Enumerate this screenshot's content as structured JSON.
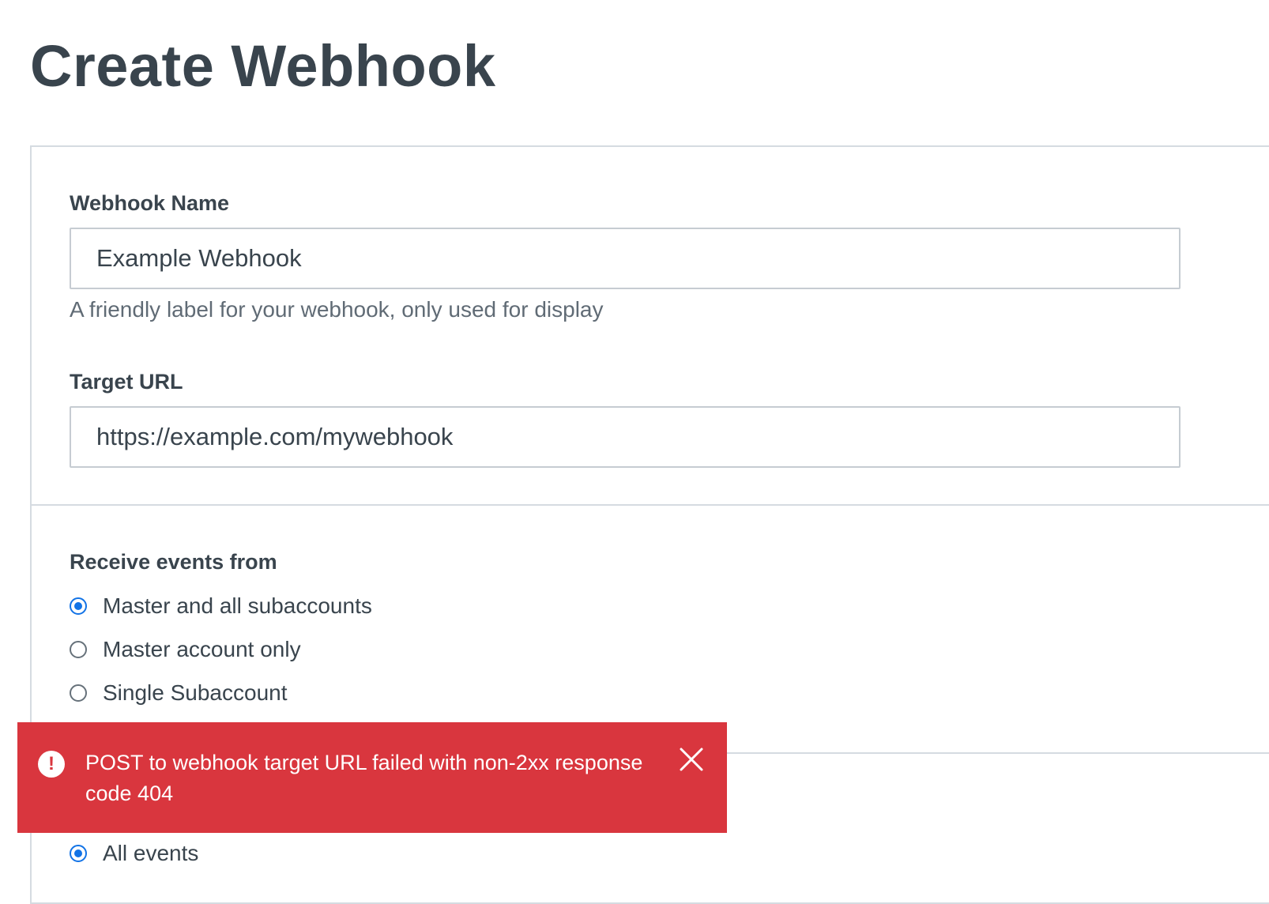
{
  "page": {
    "title": "Create Webhook"
  },
  "form": {
    "name_field": {
      "label": "Webhook Name",
      "value": "Example Webhook",
      "help": "A friendly label for your webhook, only used for display"
    },
    "url_field": {
      "label": "Target URL",
      "value": "https://example.com/mywebhook"
    },
    "receive_events": {
      "label": "Receive events from",
      "options": [
        {
          "label": "Master and all subaccounts",
          "checked": true
        },
        {
          "label": "Master account only",
          "checked": false
        },
        {
          "label": "Single Subaccount",
          "checked": false
        }
      ]
    },
    "events": {
      "options": [
        {
          "label": "All events",
          "checked": true
        }
      ]
    }
  },
  "alert": {
    "message": "POST to webhook target URL failed with non-2xx response code 404",
    "icon": "exclamation-icon",
    "close_icon": "close-icon",
    "color": "#d9363e"
  },
  "colors": {
    "accent": "#1273e6",
    "error": "#d9363e",
    "text": "#39444d",
    "border": "#d5dbe1"
  }
}
